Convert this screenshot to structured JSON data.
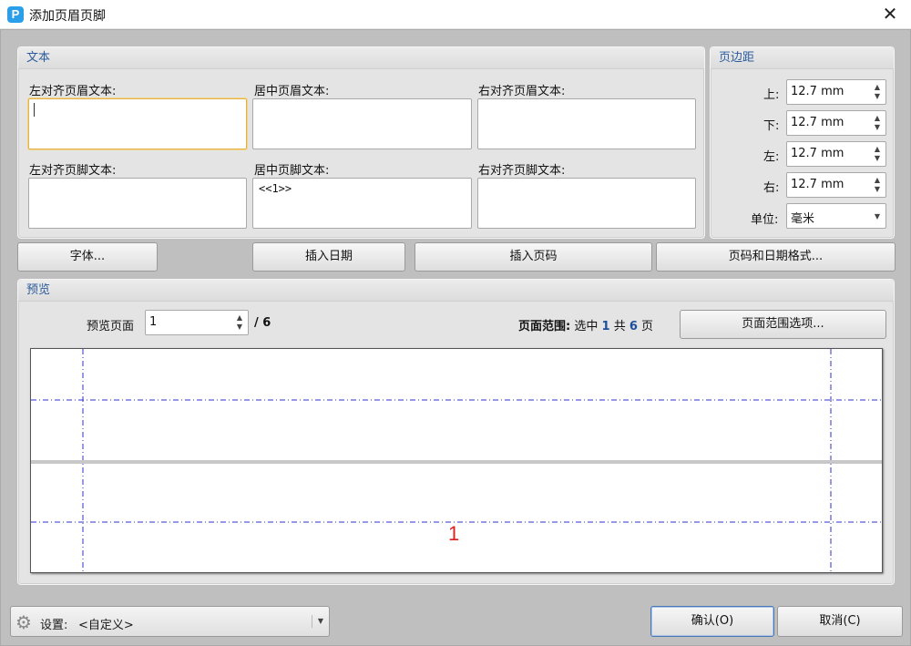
{
  "window": {
    "title": "添加页眉页脚",
    "app_icon": "P"
  },
  "text_group": {
    "title": "文本",
    "left_header_label": "左对齐页眉文本:",
    "center_header_label": "居中页眉文本:",
    "right_header_label": "右对齐页眉文本:",
    "left_footer_label": "左对齐页脚文本:",
    "center_footer_label": "居中页脚文本:",
    "right_footer_label": "右对齐页脚文本:",
    "left_header_value": "",
    "center_header_value": "",
    "right_header_value": "",
    "left_footer_value": "",
    "center_footer_value": "<<1>>",
    "right_footer_value": ""
  },
  "margins": {
    "title": "页边距",
    "top_label": "上:",
    "top_value": "12.7 mm",
    "bottom_label": "下:",
    "bottom_value": "12.7 mm",
    "left_label": "左:",
    "left_value": "12.7 mm",
    "right_label": "右:",
    "right_value": "12.7 mm",
    "unit_label": "单位:",
    "unit_value": "毫米"
  },
  "buttons": {
    "font": "字体...",
    "insert_date": "插入日期",
    "insert_page_number": "插入页码",
    "page_date_format": "页码和日期格式...",
    "page_range_options": "页面范围选项...",
    "ok": "确认(O)",
    "cancel": "取消(C)"
  },
  "preview": {
    "title": "预览",
    "page_label": "预览页面",
    "page_value": "1",
    "total_pages": "/ 6",
    "range_label": "页面范围:",
    "range_selected_text": "选中",
    "range_selected_count": "1",
    "range_total_text": "共",
    "range_total_count": "6",
    "range_unit": "页",
    "page_number_display": "1"
  },
  "settings": {
    "label": "设置:",
    "value": "<自定义>"
  },
  "colors": {
    "accent": "#2b5b9c",
    "guide": "#3030d0",
    "page_number": "#e02020"
  },
  "icons": [
    "app-icon",
    "close-icon",
    "gear-icon",
    "spin-arrows-icon",
    "dropdown-arrow-icon"
  ]
}
